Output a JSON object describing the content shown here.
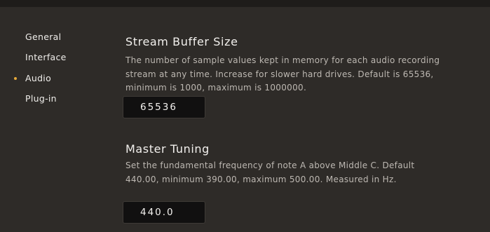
{
  "sidebar": {
    "items": [
      {
        "label": "General",
        "active": false
      },
      {
        "label": "Interface",
        "active": false
      },
      {
        "label": "Audio",
        "active": true
      },
      {
        "label": "Plug-in",
        "active": false
      }
    ]
  },
  "settings": {
    "stream_buffer": {
      "title": "Stream Buffer Size",
      "description": "The number of sample values kept in memory for each audio recording stream at any time. Increase for slower hard drives. Default is 65536, minimum is 1000, maximum is 1000000.",
      "value": "65536"
    },
    "master_tuning": {
      "title": "Master Tuning",
      "description": "Set the fundamental frequency of note A above Middle C. Default 440.00, minimum 390.00, maximum 500.00. Measured in Hz.",
      "value": "440.0"
    }
  },
  "colors": {
    "background": "#2e2b28",
    "active_dot": "#e6a93a",
    "field_background": "#111010"
  }
}
